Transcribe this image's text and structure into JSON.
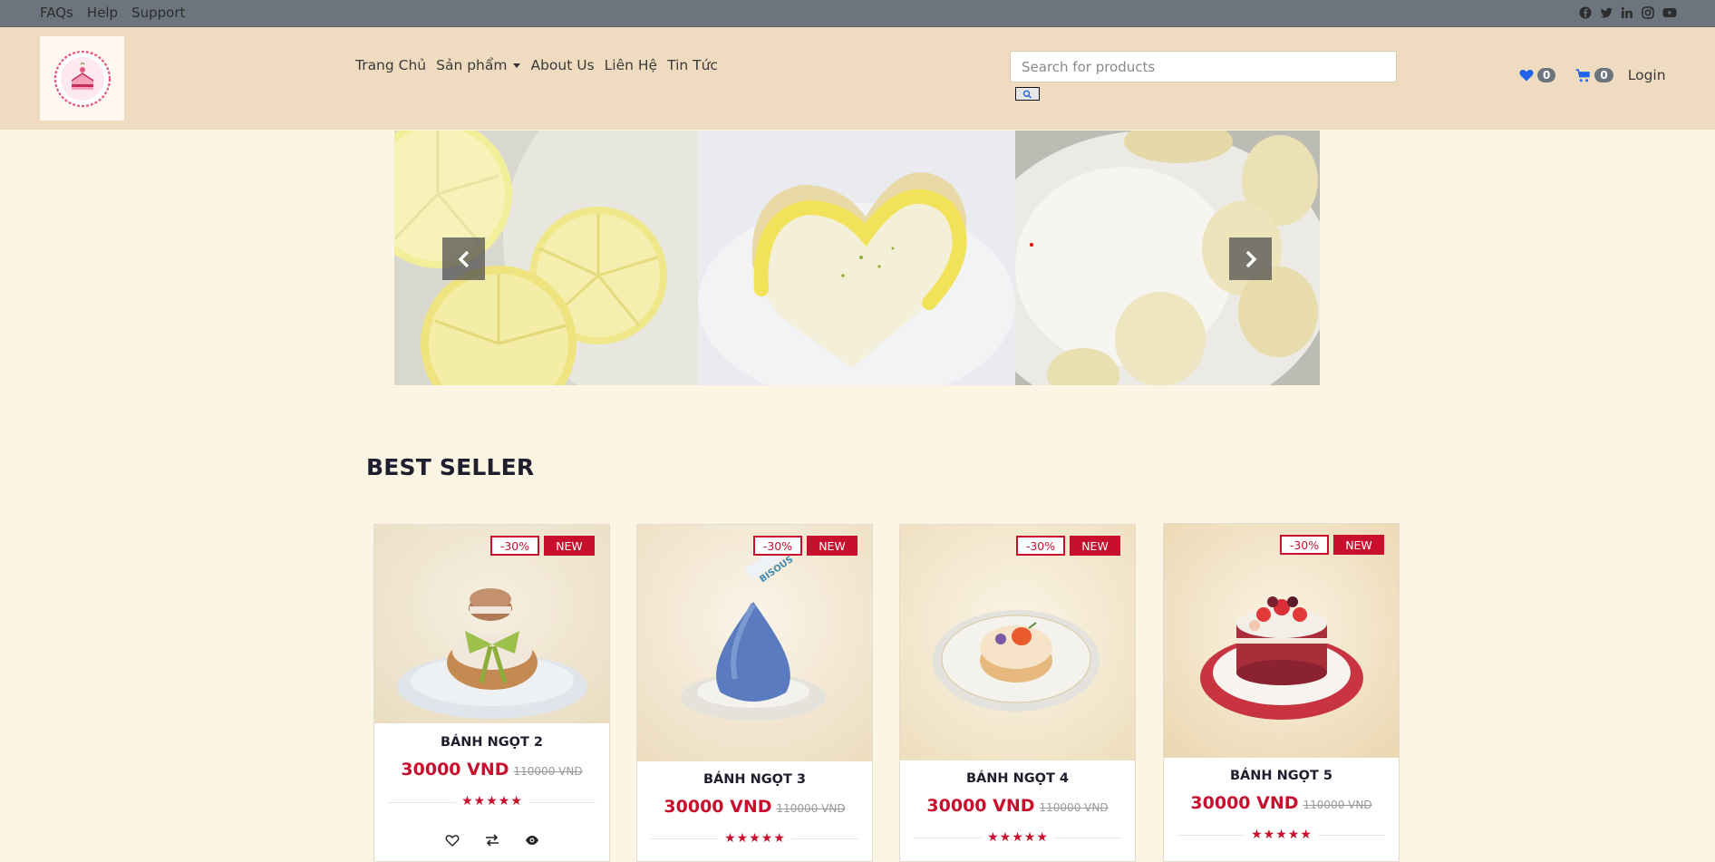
{
  "topbar": {
    "links": [
      "FAQs",
      "Help",
      "Support"
    ],
    "social_icons": [
      "facebook-icon",
      "twitter-icon",
      "linkedin-icon",
      "instagram-icon",
      "youtube-icon"
    ]
  },
  "header": {
    "nav": [
      "Trang Chủ",
      "Sản phẩm",
      "About Us",
      "Liên Hệ",
      "Tin Tức"
    ],
    "search_placeholder": "Search for products",
    "wishlist_count": "0",
    "cart_count": "0",
    "login_label": "Login"
  },
  "colors": {
    "accent": "#c8102e",
    "header_bg": "#efdcc0",
    "page_bg": "#fdf5e4",
    "topbar_bg": "#6c757d",
    "icon_blue": "#1e63e9"
  },
  "hero": {
    "slides": [
      "lemons",
      "heart-cheesecake",
      "bananas-yogurt"
    ]
  },
  "best_seller": {
    "title": "BEST SELLER",
    "products": [
      {
        "name": "BÁNH NGỌT 2",
        "price": "30000 VND",
        "old_price": "110000 VND",
        "discount": "-30%",
        "tag": "NEW",
        "rating": 5
      },
      {
        "name": "BÁNH NGỌT 3",
        "price": "30000 VND",
        "old_price": "110000 VND",
        "discount": "-30%",
        "tag": "NEW",
        "rating": 5
      },
      {
        "name": "BÁNH NGỌT 4",
        "price": "30000 VND",
        "old_price": "110000 VND",
        "discount": "-30%",
        "tag": "NEW",
        "rating": 5
      },
      {
        "name": "BÁNH NGỌT 5",
        "price": "30000 VND",
        "old_price": "110000 VND",
        "discount": "-30%",
        "tag": "NEW",
        "rating": 5
      }
    ]
  }
}
